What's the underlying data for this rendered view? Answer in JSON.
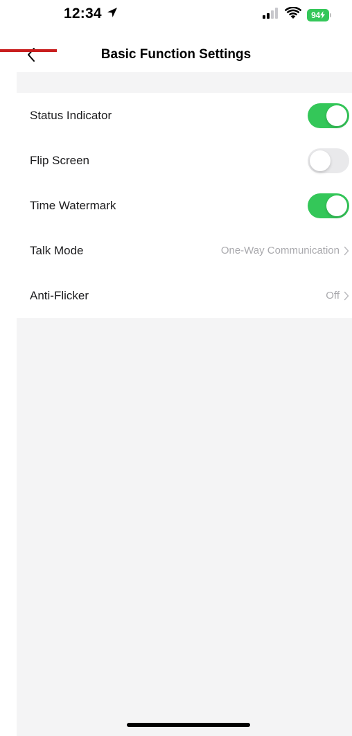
{
  "status_bar": {
    "time": "12:34",
    "location_icon": "location-arrow-icon",
    "signal_icon": "cellular-signal-icon",
    "wifi_icon": "wifi-icon",
    "battery_level": "94",
    "battery_color": "#34c759"
  },
  "nav": {
    "back_icon": "chevron-left-icon",
    "title": "Basic Function Settings",
    "annotation_color": "#c81e1e"
  },
  "settings": {
    "status_indicator": {
      "label": "Status Indicator",
      "state": "on"
    },
    "flip_screen": {
      "label": "Flip Screen",
      "state": "off"
    },
    "time_watermark": {
      "label": "Time Watermark",
      "state": "on"
    },
    "talk_mode": {
      "label": "Talk Mode",
      "value": "One-Way Communication",
      "chevron_icon": "chevron-right-icon"
    },
    "anti_flicker": {
      "label": "Anti-Flicker",
      "value": "Off",
      "chevron_icon": "chevron-right-icon"
    }
  },
  "colors": {
    "toggle_on": "#34c759",
    "toggle_off": "#e9e9eb",
    "background_gray": "#f4f4f5",
    "secondary_text": "#a9a9ad"
  }
}
